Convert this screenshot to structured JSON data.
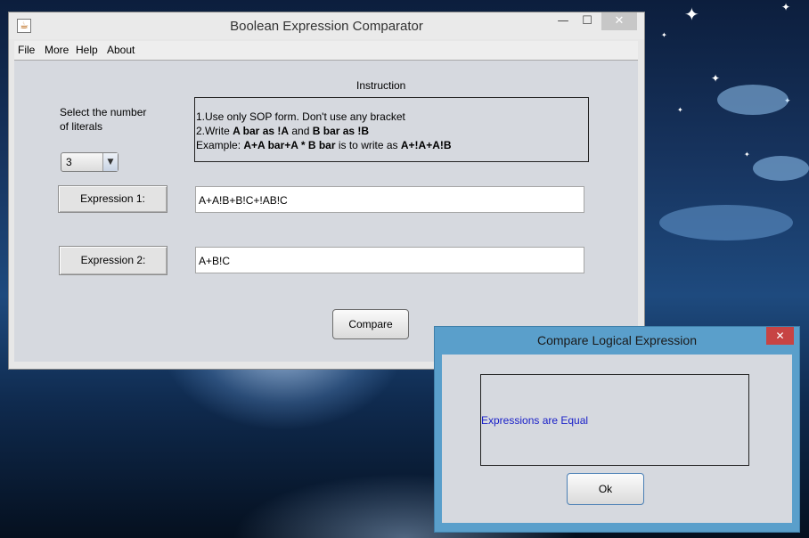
{
  "main_window": {
    "title": "Boolean Expression Comparator",
    "controls": {
      "minimize": "—",
      "maximize": "☐",
      "close": "✕"
    }
  },
  "menu": [
    "File",
    "More",
    "Help",
    "About"
  ],
  "form": {
    "literals_label_line1": "Select the number",
    "literals_label_line2": "of literals",
    "literals_value": "3",
    "instruction_heading": "Instruction",
    "instructions": {
      "line1": "1.Use only SOP form. Don't use any bracket",
      "line2_prefix": "2.Write ",
      "line2_bold1": "A bar as !A",
      "line2_mid": " and ",
      "line2_bold2": "B bar as !B",
      "line3_prefix": "Example: ",
      "line3_bold1": "A+A bar+A * B bar",
      "line3_mid": " is to write as ",
      "line3_bold2": "A+!A+A!B"
    },
    "expr1_label": "Expression 1:",
    "expr1_value": "A+A!B+B!C+!AB!C",
    "expr2_label": "Expression 2:",
    "expr2_value": "A+B!C",
    "compare_label": "Compare"
  },
  "dialog": {
    "title": "Compare Logical Expression",
    "close": "✕",
    "message": "Expressions are Equal",
    "ok_label": "Ok"
  },
  "colors": {
    "message_text": "#1a20c8",
    "dialog_frame": "#5a9fcb",
    "dialog_close": "#c74444"
  }
}
